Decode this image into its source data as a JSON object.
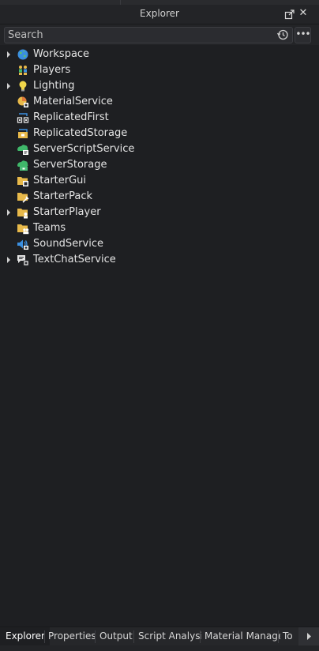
{
  "panel": {
    "title": "Explorer"
  },
  "search": {
    "placeholder": "Search"
  },
  "tree": [
    {
      "label": "Workspace",
      "icon": "workspace-globe-icon",
      "expandable": true
    },
    {
      "label": "Players",
      "icon": "players-icon",
      "expandable": false
    },
    {
      "label": "Lighting",
      "icon": "lightbulb-icon",
      "expandable": true
    },
    {
      "label": "MaterialService",
      "icon": "material-service-icon",
      "expandable": false
    },
    {
      "label": "ReplicatedFirst",
      "icon": "replicated-first-icon",
      "expandable": false
    },
    {
      "label": "ReplicatedStorage",
      "icon": "replicated-storage-icon",
      "expandable": false
    },
    {
      "label": "ServerScriptService",
      "icon": "server-script-service-icon",
      "expandable": false
    },
    {
      "label": "ServerStorage",
      "icon": "server-storage-icon",
      "expandable": false
    },
    {
      "label": "StarterGui",
      "icon": "starter-gui-icon",
      "expandable": false
    },
    {
      "label": "StarterPack",
      "icon": "starter-pack-icon",
      "expandable": false
    },
    {
      "label": "StarterPlayer",
      "icon": "starter-player-icon",
      "expandable": true
    },
    {
      "label": "Teams",
      "icon": "teams-icon",
      "expandable": false
    },
    {
      "label": "SoundService",
      "icon": "sound-service-icon",
      "expandable": false
    },
    {
      "label": "TextChatService",
      "icon": "text-chat-service-icon",
      "expandable": true
    }
  ],
  "bottom_tabs": [
    {
      "label": "Explorer",
      "active": true
    },
    {
      "label": "Properties",
      "active": false
    },
    {
      "label": "Output",
      "active": false
    },
    {
      "label": "Script Analysis",
      "active": false
    },
    {
      "label": "Material Manager",
      "active": false
    },
    {
      "label": "To",
      "active": false
    }
  ],
  "colors": {
    "background": "#1e1f22",
    "panel": "#232427",
    "text": "#e4e4e4",
    "folder_yellow": "#e8b94a",
    "server_green": "#3fb86a",
    "globe_blue": "#3b8fe0"
  }
}
